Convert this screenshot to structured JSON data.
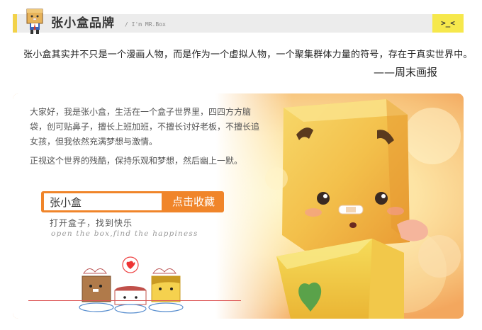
{
  "header": {
    "title": "张小盒品牌",
    "subtitle": "/ I'm MR.Box",
    "emoji": ">_<"
  },
  "quote": {
    "text": "张小盒其实并不只是一个漫画人物，而是作为一个虚拟人物，一个聚集群体力量的符号，存在于真实世界中。",
    "source": "——周末画报"
  },
  "intro": {
    "paragraph1": "大家好，我是张小盒，生活在一个盒子世界里，四四方方脑袋，创可贴鼻子，擅长上班加班，不擅长讨好老板，不擅长追女孩，但我依然充满梦想与激情。",
    "paragraph2": "正视这个世界的残酷，保持乐观和梦想，然后幽上一默。"
  },
  "search": {
    "value": "张小盒",
    "button_label": "点击收藏"
  },
  "slogan": {
    "cn": "打开盒子，找到快乐",
    "en": "open the box,find the happiness"
  },
  "colors": {
    "accent_orange": "#f0852a",
    "header_yellow": "#f2d24a",
    "emoji_yellow": "#f6e84c",
    "header_gray": "#ececec"
  }
}
